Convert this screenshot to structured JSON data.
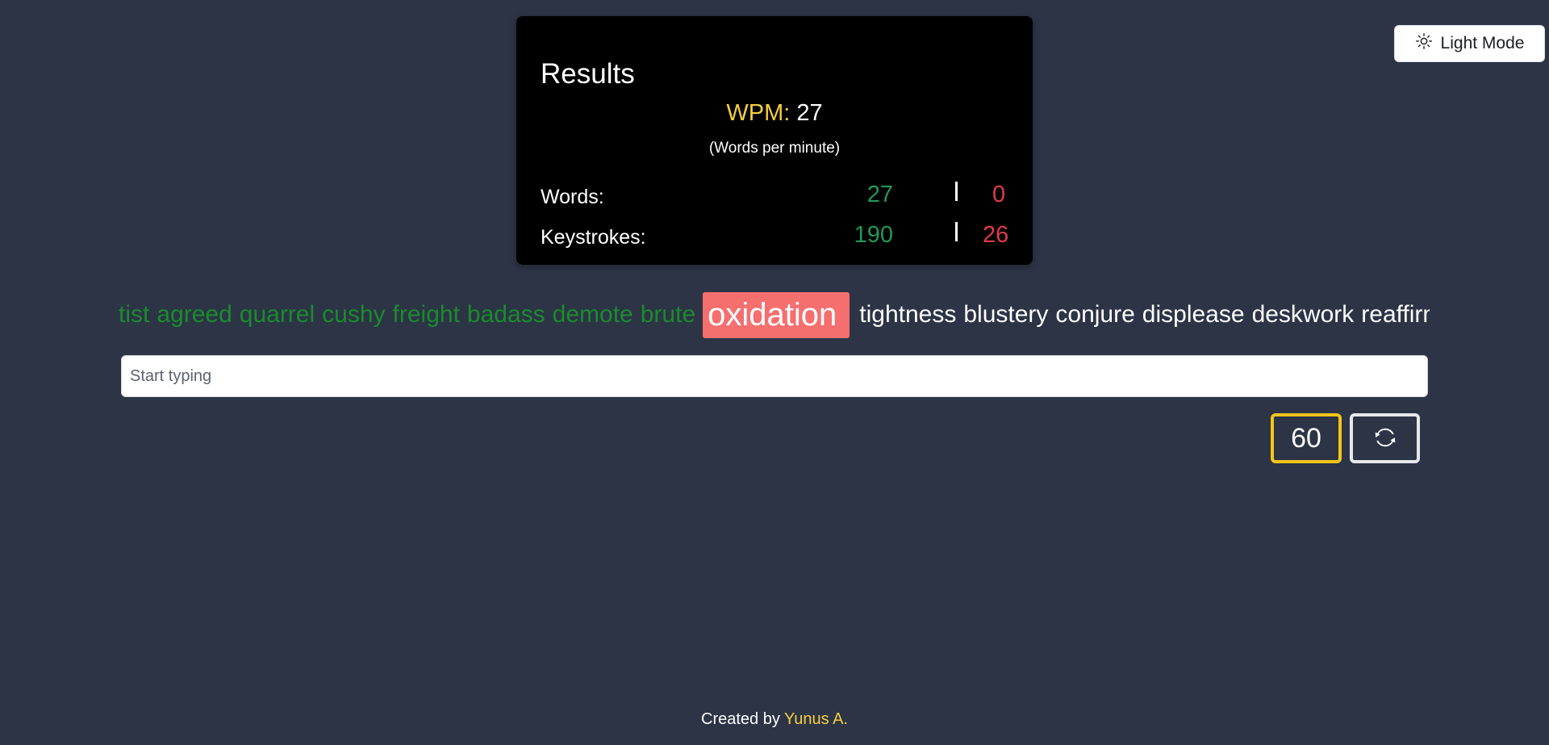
{
  "theme_toggle": {
    "label": "Light Mode",
    "icon": "sun-icon"
  },
  "results": {
    "title": "Results",
    "wpm_label": "WPM:",
    "wpm_value": "27",
    "wpm_caption": "(Words per minute)",
    "words": {
      "label": "Words:",
      "correct": "27",
      "incorrect": "0"
    },
    "keystrokes": {
      "label": "Keystrokes:",
      "correct": "190",
      "incorrect": "26"
    },
    "colors": {
      "correct": "#1f9a55",
      "incorrect": "#e03a4a",
      "wpm_label": "#f5cf3c"
    }
  },
  "word_strip": {
    "completed": [
      "tist",
      "agreed",
      "quarrel",
      "cushy",
      "freight",
      "badass",
      "demote",
      "brute"
    ],
    "current": "oxidation",
    "upcoming": [
      "tightness",
      "blustery",
      "conjure",
      "displease",
      "deskwork",
      "reaffirm"
    ]
  },
  "input": {
    "placeholder": "Start typing",
    "value": ""
  },
  "timer": {
    "value": "60"
  },
  "reset_button": {
    "icon": "refresh-icon"
  },
  "footer": {
    "prefix": "Created by ",
    "author": "Yunus A."
  }
}
